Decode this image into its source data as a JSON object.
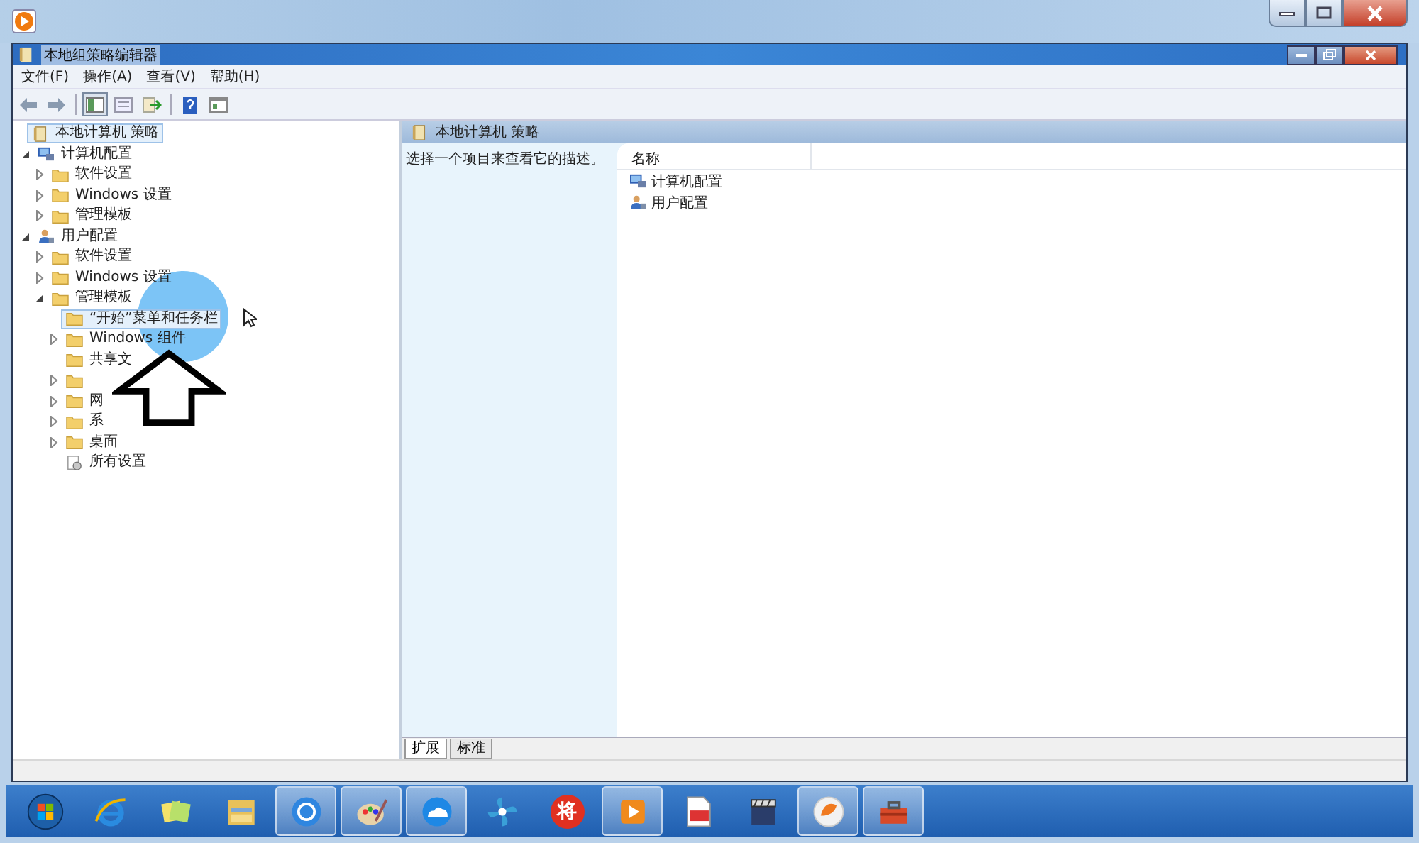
{
  "window": {
    "title": "本地组策略编辑器"
  },
  "menu": [
    "文件(F)",
    "操作(A)",
    "查看(V)",
    "帮助(H)"
  ],
  "toolbar": [
    {
      "kind": "back",
      "pressed": false
    },
    {
      "kind": "forward",
      "pressed": false
    },
    {
      "kind": "tree",
      "pressed": true
    },
    {
      "kind": "properties",
      "pressed": false
    },
    {
      "kind": "export",
      "pressed": false
    },
    {
      "kind": "help",
      "pressed": false
    },
    {
      "kind": "view",
      "pressed": false
    }
  ],
  "tree": [
    {
      "label": "本地计算机 策略",
      "kind": "policy",
      "selected": true,
      "children": [
        {
          "label": "计算机配置",
          "kind": "computer",
          "expanded": true,
          "selected": false,
          "children": [
            {
              "label": "软件设置",
              "kind": "folder",
              "expanded": false,
              "selected": false
            },
            {
              "label": "Windows 设置",
              "kind": "folder",
              "expanded": false,
              "selected": false
            },
            {
              "label": "管理模板",
              "kind": "folder",
              "expanded": false,
              "selected": false
            }
          ]
        },
        {
          "label": "用户配置",
          "kind": "user",
          "expanded": true,
          "selected": false,
          "children": [
            {
              "label": "软件设置",
              "kind": "folder",
              "expanded": false,
              "selected": false
            },
            {
              "label": "Windows 设置",
              "kind": "folder",
              "expanded": false,
              "selected": false
            },
            {
              "label": "管理模板",
              "kind": "folder",
              "expanded": true,
              "selected": false,
              "children": [
                {
                  "label": "“开始”菜单和任务栏",
                  "kind": "folder",
                  "selected": true
                },
                {
                  "label": "Windows 组件",
                  "kind": "folder",
                  "expanded": false,
                  "selected": false
                },
                {
                  "label": "共享文",
                  "kind": "folder",
                  "selected": false
                },
                {
                  "kind": "folder",
                  "expanded": false,
                  "selected": false
                },
                {
                  "label": "网",
                  "kind": "folder",
                  "expanded": false,
                  "selected": false
                },
                {
                  "label": "系",
                  "kind": "folder",
                  "expanded": false,
                  "selected": false
                },
                {
                  "label": "桌面",
                  "kind": "folder",
                  "expanded": false,
                  "selected": false
                },
                {
                  "label": "所有设置",
                  "kind": "settings",
                  "selected": false
                }
              ]
            }
          ]
        }
      ]
    }
  ],
  "detail": {
    "header": "本地计算机 策略",
    "description": "选择一个项目来查看它的描述。",
    "column": "名称",
    "items": [
      {
        "label": "计算机配置",
        "kind": "computer"
      },
      {
        "label": "用户配置",
        "kind": "user"
      }
    ]
  },
  "tabs": [
    {
      "label": "扩展",
      "selected": true
    },
    {
      "label": "标准",
      "selected": false
    }
  ],
  "taskbar": [
    {
      "kind": "start",
      "active": false
    },
    {
      "kind": "ie",
      "active": false
    },
    {
      "kind": "notes",
      "active": false
    },
    {
      "kind": "explorer",
      "active": false
    },
    {
      "kind": "dots",
      "active": true
    },
    {
      "kind": "palette",
      "active": true
    },
    {
      "kind": "cloud",
      "active": true
    },
    {
      "kind": "pinwheel",
      "active": false
    },
    {
      "kind": "badge",
      "label": "将",
      "active": false
    },
    {
      "kind": "play",
      "active": true
    },
    {
      "kind": "document",
      "active": false
    },
    {
      "kind": "clapper",
      "active": false
    },
    {
      "kind": "orange",
      "active": true
    },
    {
      "kind": "toolbox",
      "active": true
    }
  ]
}
